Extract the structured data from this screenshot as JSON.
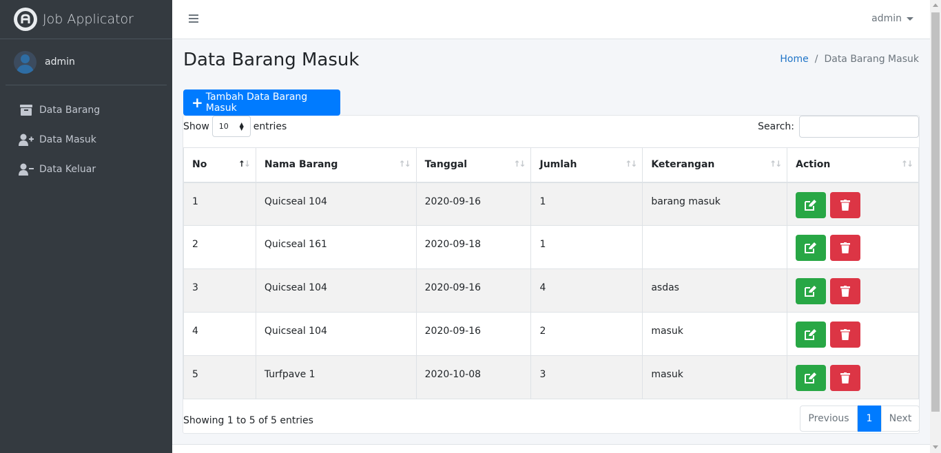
{
  "brand": {
    "name": "Job Applicator",
    "logo_letter": "A"
  },
  "user": {
    "name": "admin"
  },
  "sidebar": {
    "items": [
      {
        "label": "Data Barang",
        "icon": "archive-icon"
      },
      {
        "label": "Data Masuk",
        "icon": "user-plus-icon"
      },
      {
        "label": "Data Keluar",
        "icon": "user-minus-icon"
      }
    ]
  },
  "topbar": {
    "user_menu_label": "admin"
  },
  "page": {
    "title": "Data Barang Masuk",
    "breadcrumb": {
      "home": "Home",
      "current": "Data Barang Masuk"
    }
  },
  "toolbar": {
    "add_label": "Tambah Data Barang Masuk"
  },
  "datatable": {
    "show_label": "Show",
    "entries_label": "entries",
    "length_value": "10",
    "search_label": "Search:",
    "search_value": "",
    "columns": [
      "No",
      "Nama Barang",
      "Tanggal",
      "Jumlah",
      "Keterangan",
      "Action"
    ],
    "rows": [
      {
        "no": "1",
        "nama": "Quicseal 104",
        "tanggal": "2020-09-16",
        "jumlah": "1",
        "keterangan": "barang masuk"
      },
      {
        "no": "2",
        "nama": "Quicseal 161",
        "tanggal": "2020-09-18",
        "jumlah": "1",
        "keterangan": ""
      },
      {
        "no": "3",
        "nama": "Quicseal 104",
        "tanggal": "2020-09-16",
        "jumlah": "4",
        "keterangan": "asdas"
      },
      {
        "no": "4",
        "nama": "Quicseal 104",
        "tanggal": "2020-09-16",
        "jumlah": "2",
        "keterangan": "masuk"
      },
      {
        "no": "5",
        "nama": "Turfpave 1",
        "tanggal": "2020-10-08",
        "jumlah": "3",
        "keterangan": "masuk"
      }
    ],
    "info": "Showing 1 to 5 of 5 entries",
    "pagination": {
      "previous": "Previous",
      "current": "1",
      "next": "Next"
    }
  },
  "colors": {
    "sidebar_bg": "#343a40",
    "primary": "#007bff",
    "success": "#28a745",
    "danger": "#dc3545"
  }
}
